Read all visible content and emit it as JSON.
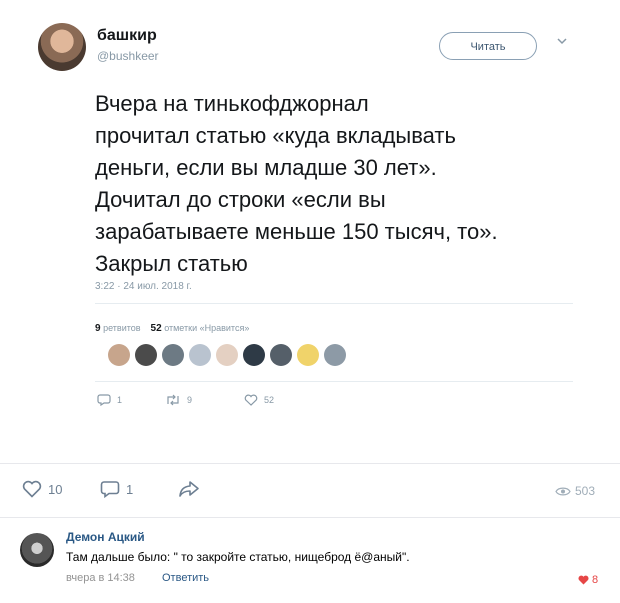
{
  "tweet": {
    "author_name": "башкир",
    "author_handle": "@bushkeer",
    "follow_label": "Читать",
    "text_lines": [
      "Вчера на тинькофджорнал",
      "прочитал статью «куда вкладывать",
      "деньги, если вы младше 30 лет».",
      "Дочитал до строки «если вы",
      "зарабатываете меньше 150 тысяч, то».",
      "Закрыл статью"
    ],
    "timestamp": "3:22 · 24 июл. 2018 г.",
    "retweets_count": "9",
    "retweets_label": "ретвитов",
    "likes_count": "52",
    "likes_label": "отметки «Нравится»",
    "reply_count": "1",
    "retweet_count": "9",
    "like_count": "52"
  },
  "post": {
    "likes": "10",
    "comments": "1",
    "views": "503"
  },
  "comment": {
    "author": "Демон Ацкий",
    "text": "Там дальше было: \" то закройте статью, нищеброд ё@аный\".",
    "time": "вчера в 14:38",
    "reply_label": "Ответить",
    "likes": "8"
  },
  "colors": {
    "vk_link": "#2a5885",
    "like_red": "#e64646",
    "twitter_gray": "#8899a6"
  }
}
